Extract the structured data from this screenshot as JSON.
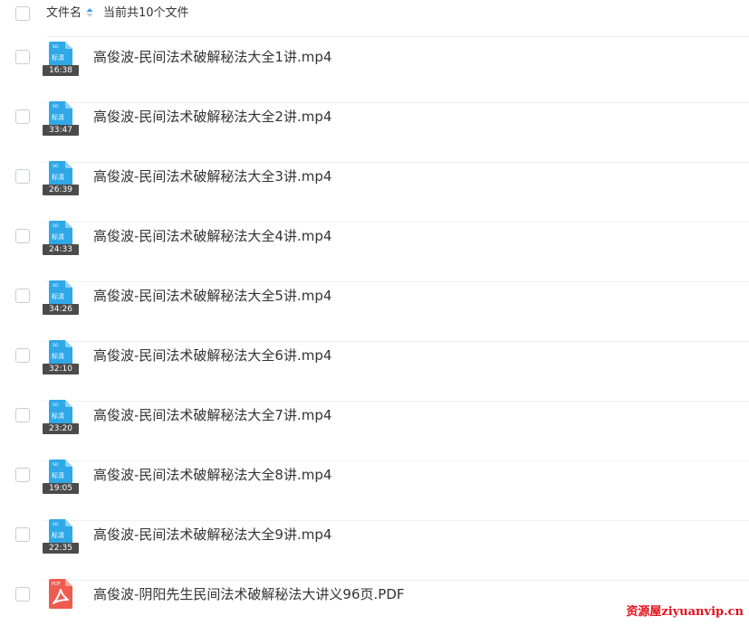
{
  "header": {
    "name_column_label": "文件名",
    "count_text": "当前共10个文件"
  },
  "files": [
    {
      "name": "高俊波-民间法术破解秘法大全1讲.mp4",
      "type": "video",
      "badge": "标清",
      "duration": "16:38"
    },
    {
      "name": "高俊波-民间法术破解秘法大全2讲.mp4",
      "type": "video",
      "badge": "标清",
      "duration": "33:47"
    },
    {
      "name": "高俊波-民间法术破解秘法大全3讲.mp4",
      "type": "video",
      "badge": "标清",
      "duration": "26:39"
    },
    {
      "name": "高俊波-民间法术破解秘法大全4讲.mp4",
      "type": "video",
      "badge": "标清",
      "duration": "24:33"
    },
    {
      "name": "高俊波-民间法术破解秘法大全5讲.mp4",
      "type": "video",
      "badge": "标清",
      "duration": "34:26"
    },
    {
      "name": "高俊波-民间法术破解秘法大全6讲.mp4",
      "type": "video",
      "badge": "标清",
      "duration": "32:10"
    },
    {
      "name": "高俊波-民间法术破解秘法大全7讲.mp4",
      "type": "video",
      "badge": "标清",
      "duration": "23:20"
    },
    {
      "name": "高俊波-民间法术破解秘法大全8讲.mp4",
      "type": "video",
      "badge": "标清",
      "duration": "19:05"
    },
    {
      "name": "高俊波-民间法术破解秘法大全9讲.mp4",
      "type": "video",
      "badge": "标清",
      "duration": "22:35"
    },
    {
      "name": "高俊波-阴阳先生民间法术破解秘法大讲义96页.PDF",
      "type": "pdf",
      "badge": "PDF",
      "duration": ""
    }
  ],
  "watermark": "资源屋ziyuanvip.cn",
  "colors": {
    "video_icon": "#2fa8e8",
    "video_icon_fold": "#8fd0f3",
    "pdf_icon": "#f05b50",
    "pdf_icon_fold": "#f7a59e",
    "watermark": "#e0101a"
  }
}
